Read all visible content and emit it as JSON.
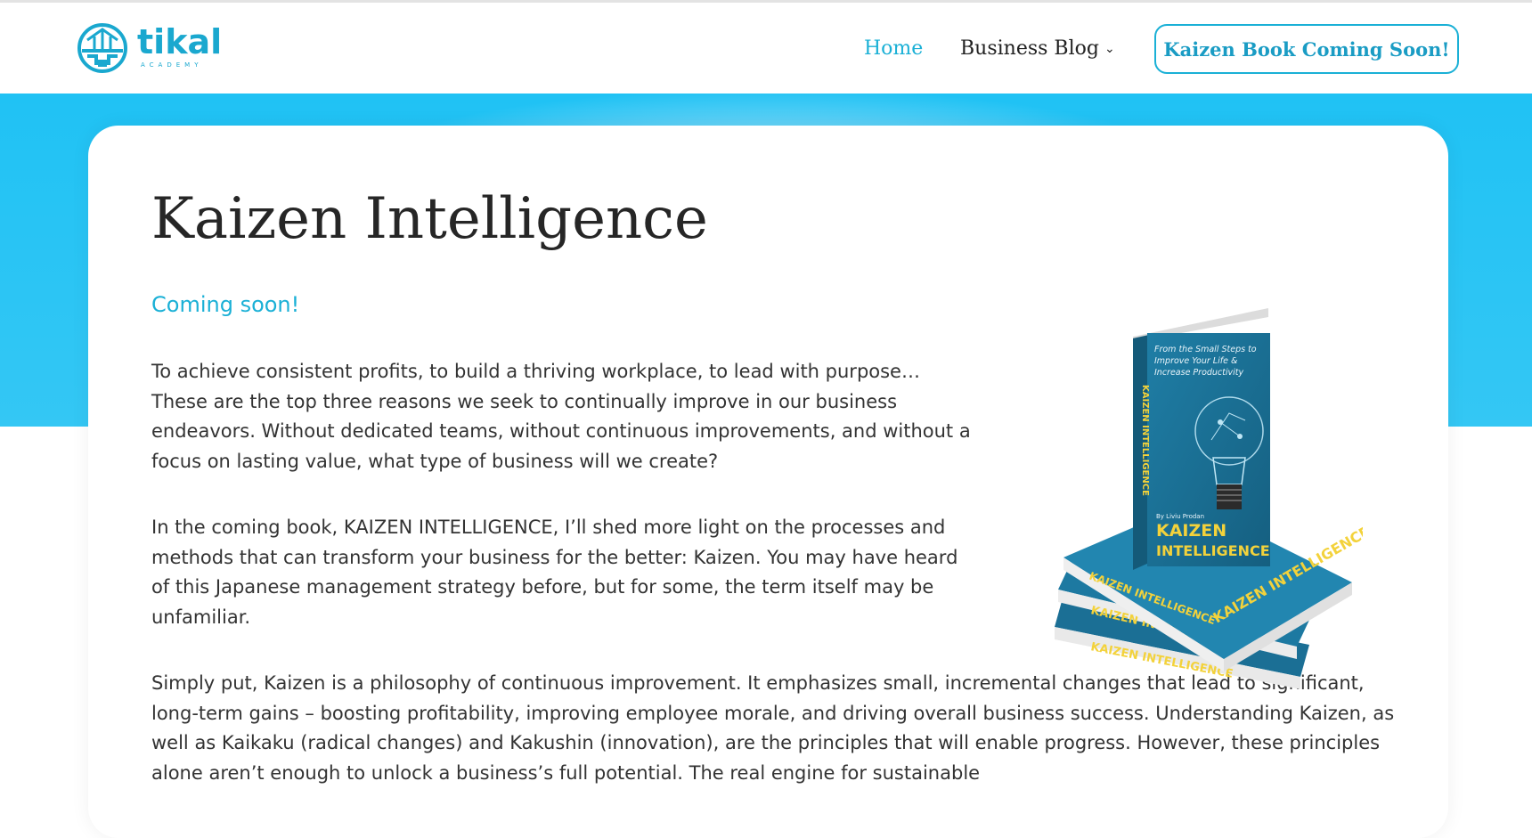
{
  "brand": {
    "name": "tikal",
    "sub": "ACADEMY",
    "accent": "#1ab0d6",
    "hero_color": "#29c3f4"
  },
  "nav": {
    "items": [
      {
        "label": "Home",
        "active": true
      },
      {
        "label": "Business Blog",
        "has_dropdown": true
      }
    ],
    "cta_label": "Kaizen Book Coming Soon!"
  },
  "page": {
    "title": "Kaizen Intelligence",
    "subtitle": "Coming soon!",
    "paragraphs": [
      "To achieve consistent profits, to build a thriving workplace, to lead with purpose… These are the top three reasons we seek to continually improve in our business endeavors. Without dedicated teams, without continuous improvements, and without a focus on lasting value, what type of business will we create?",
      "In the coming book, KAIZEN INTELLIGENCE, I’ll shed more light on the processes and methods that can transform your business for the better: Kaizen. You may have heard of this Japanese management strategy before, but for some, the term itself may be unfamiliar.",
      "Simply put, Kaizen is a philosophy of continuous improvement. It emphasizes small, incremental changes that lead to significant, long-term gains – boosting profitability, improving employee morale, and driving overall business success. Understanding Kaizen, as well as Kaikaku (radical changes) and Kakushin (innovation), are the principles that will enable progress. However, these principles alone aren’t enough to unlock a business’s full potential. The real engine for sustainable"
    ]
  },
  "book": {
    "tagline": "From the Small Steps to Improve Your Life & Increase Productivity",
    "author": "By Liviu Prodan",
    "title_line1": "KAIZEN",
    "title_line2": "INTELLIGENCE",
    "spine": "KAIZEN INTELLIGENCE",
    "cover_color": "#1d7fa6",
    "title_color": "#f3d23b"
  }
}
